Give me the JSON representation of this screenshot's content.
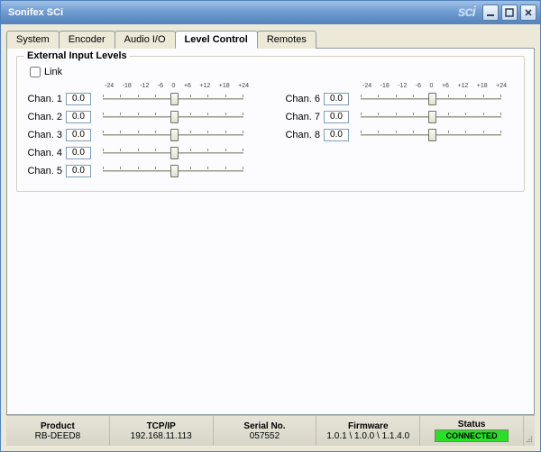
{
  "title": "Sonifex SCi",
  "logo": "sci",
  "tabs": [
    {
      "label": "System"
    },
    {
      "label": "Encoder"
    },
    {
      "label": "Audio I/O"
    },
    {
      "label": "Level Control"
    },
    {
      "label": "Remotes"
    }
  ],
  "active_tab": 3,
  "group_title": "External Input Levels",
  "link_label": "Link",
  "link_checked": false,
  "scale": [
    "-24",
    "-18",
    "-12",
    "-6",
    "0",
    "+6",
    "+12",
    "+18",
    "+24"
  ],
  "channels_left": [
    {
      "label": "Chan. 1",
      "value": "0.0",
      "pos": 0
    },
    {
      "label": "Chan. 2",
      "value": "0.0",
      "pos": 0
    },
    {
      "label": "Chan. 3",
      "value": "0.0",
      "pos": 0
    },
    {
      "label": "Chan. 4",
      "value": "0.0",
      "pos": 0
    },
    {
      "label": "Chan. 5",
      "value": "0.0",
      "pos": 0
    }
  ],
  "channels_right": [
    {
      "label": "Chan. 6",
      "value": "0.0",
      "pos": 0
    },
    {
      "label": "Chan. 7",
      "value": "0.0",
      "pos": 0
    },
    {
      "label": "Chan. 8",
      "value": "0.0",
      "pos": 0
    }
  ],
  "status": {
    "headers": {
      "product": "Product",
      "ip": "TCP/IP",
      "serial": "Serial No.",
      "fw": "Firmware",
      "status": "Status"
    },
    "product": "RB-DEED8",
    "ip": "192.168.11.113",
    "serial": "057552",
    "firmware": "1.0.1 \\ 1.0.0 \\ 1.1.4.0",
    "connected": "CONNECTED"
  }
}
